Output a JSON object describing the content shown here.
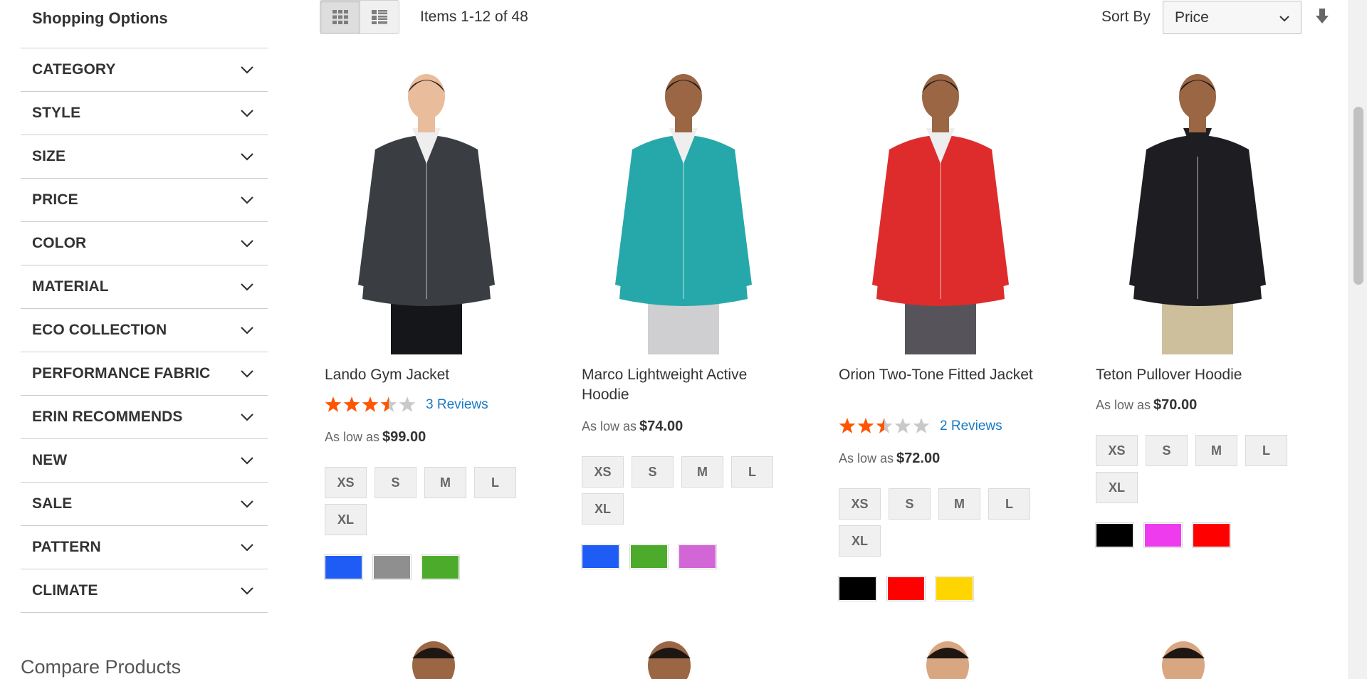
{
  "sidebar": {
    "title": "Shopping Options",
    "filters": [
      {
        "label": "CATEGORY"
      },
      {
        "label": "STYLE"
      },
      {
        "label": "SIZE"
      },
      {
        "label": "PRICE"
      },
      {
        "label": "COLOR"
      },
      {
        "label": "MATERIAL"
      },
      {
        "label": "ECO COLLECTION"
      },
      {
        "label": "PERFORMANCE FABRIC"
      },
      {
        "label": "ERIN RECOMMENDS"
      },
      {
        "label": "NEW"
      },
      {
        "label": "SALE"
      },
      {
        "label": "PATTERN"
      },
      {
        "label": "CLIMATE"
      }
    ],
    "compare_title": "Compare Products"
  },
  "toolbar": {
    "amount": "Items 1-12 of 48",
    "sort_label": "Sort By",
    "sort_value": "Price"
  },
  "products": [
    {
      "name": "Lando Gym Jacket",
      "rating": 3.5,
      "reviews": "3 Reviews",
      "price_label": "As low as",
      "price": "$99.00",
      "sizes": [
        "XS",
        "S",
        "M",
        "L",
        "XL"
      ],
      "colors": [
        "#1f5cf5",
        "#8f8f8f",
        "#4cab2a"
      ],
      "garment": "#3a3d42"
    },
    {
      "name": "Marco Lightweight Active Hoodie",
      "rating": null,
      "reviews": "",
      "price_label": "As low as",
      "price": "$74.00",
      "sizes": [
        "XS",
        "S",
        "M",
        "L",
        "XL"
      ],
      "colors": [
        "#1f5cf5",
        "#4cab2a",
        "#d266d6"
      ],
      "garment": "#26a8aa"
    },
    {
      "name": "Orion Two-Tone Fitted Jacket",
      "rating": 2.5,
      "reviews": "2 Reviews",
      "price_label": "As low as",
      "price": "$72.00",
      "sizes": [
        "XS",
        "S",
        "M",
        "L",
        "XL"
      ],
      "colors": [
        "#000000",
        "#ff0000",
        "#ffd500"
      ],
      "garment": "#de2c2c"
    },
    {
      "name": "Teton Pullover Hoodie",
      "rating": null,
      "reviews": "",
      "price_label": "As low as",
      "price": "$70.00",
      "sizes": [
        "XS",
        "S",
        "M",
        "L",
        "XL"
      ],
      "colors": [
        "#000000",
        "#ee3bee",
        "#ff0000"
      ],
      "garment": "#1e1e22"
    }
  ],
  "icons": {
    "filter_toggle": "chevron-down-icon",
    "grid_mode": "grid-icon",
    "list_mode": "list-icon",
    "sort_direction": "arrow-down-icon",
    "star": "star-icon"
  },
  "colors": {
    "link": "#1979c3",
    "star_on": "#ff5501",
    "star_off": "#c9c9c9"
  }
}
